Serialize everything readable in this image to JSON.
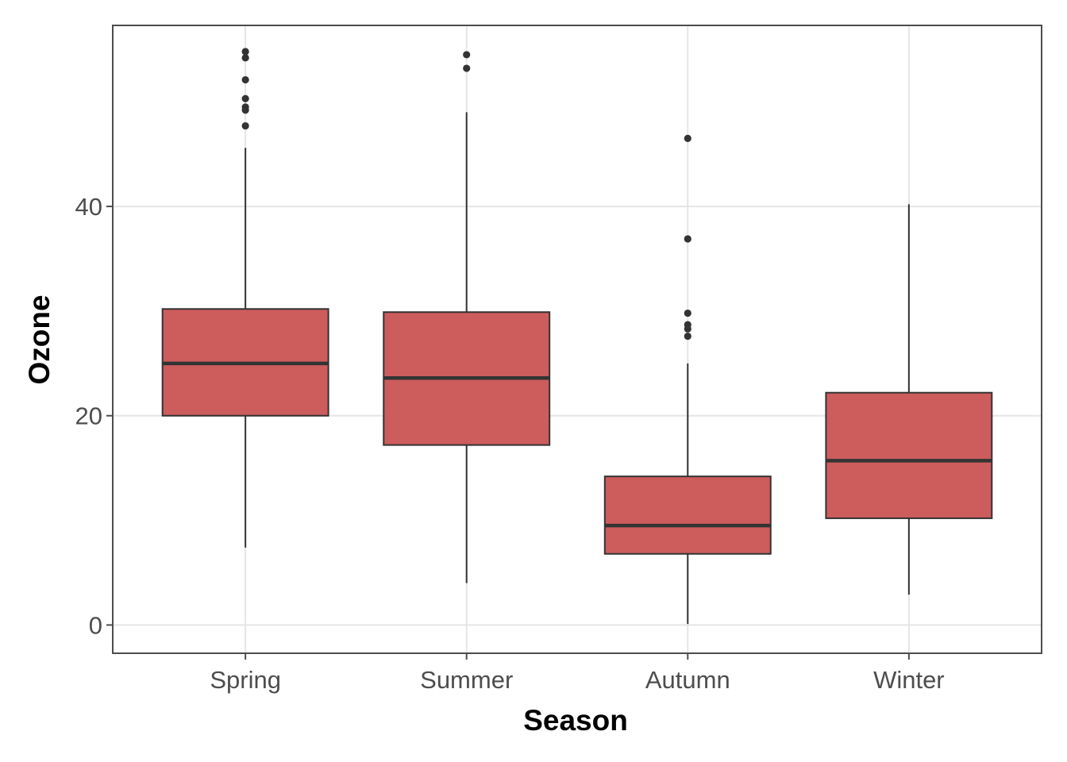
{
  "chart_data": {
    "type": "boxplot",
    "title": "",
    "xlabel": "Season",
    "ylabel": "Ozone",
    "ylim": [
      -2.7,
      57.3
    ],
    "yticks": [
      0,
      20,
      40
    ],
    "ytick_labels": [
      "0",
      "20",
      "40"
    ],
    "grid": true,
    "legend": "none",
    "fill_color": "#CD5C5C",
    "line_color": "#333333",
    "categories": [
      "Spring",
      "Summer",
      "Autumn",
      "Winter"
    ],
    "boxes": [
      {
        "category": "Spring",
        "whisker_low": 7.4,
        "q1": 20.0,
        "median": 25.0,
        "q3": 30.2,
        "whisker_high": 45.6,
        "outliers": [
          54.8,
          54.2,
          52.1,
          50.3,
          49.5,
          49.2,
          47.7
        ]
      },
      {
        "category": "Summer",
        "whisker_low": 4.0,
        "q1": 17.2,
        "median": 23.6,
        "q3": 29.9,
        "whisker_high": 49.0,
        "outliers": [
          54.5,
          53.2
        ]
      },
      {
        "category": "Autumn",
        "whisker_low": 0.1,
        "q1": 6.8,
        "median": 9.5,
        "q3": 14.2,
        "whisker_high": 25.0,
        "outliers": [
          46.5,
          36.9,
          29.8,
          28.7,
          28.3,
          27.6
        ]
      },
      {
        "category": "Winter",
        "whisker_low": 2.9,
        "q1": 10.2,
        "median": 15.7,
        "q3": 22.2,
        "whisker_high": 40.2,
        "outliers": []
      }
    ]
  }
}
